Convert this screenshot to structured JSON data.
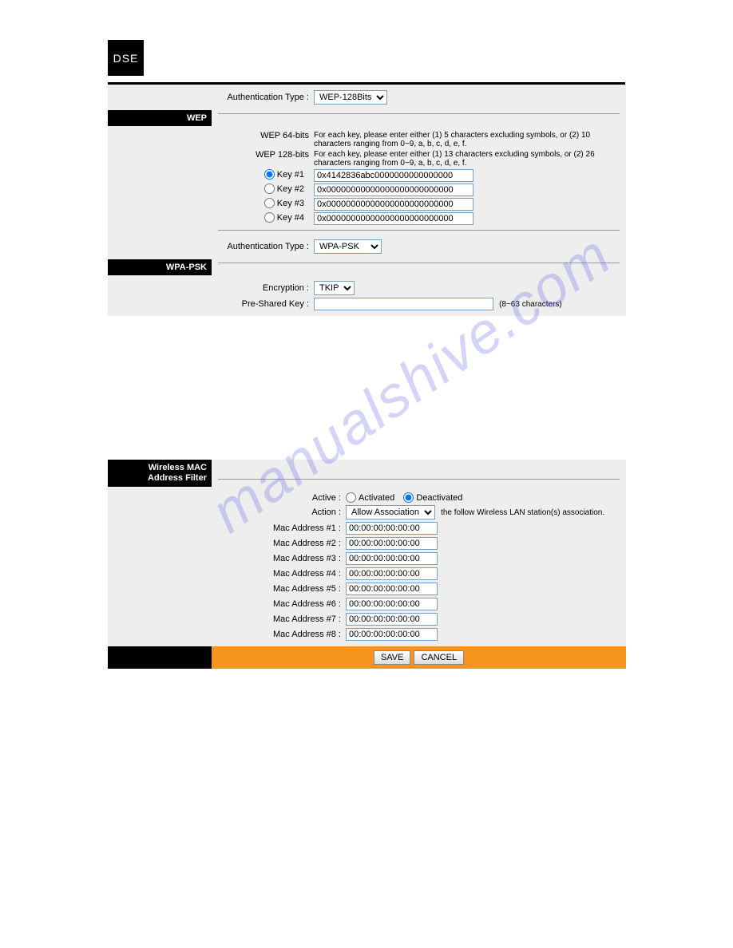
{
  "logo_text": "DSE",
  "watermark_text": "manualshive.com",
  "wep": {
    "auth_label": "Authentication Type :",
    "auth_value": "WEP-128Bits",
    "section_title": "WEP",
    "info64_label": "WEP 64-bits",
    "info64_text": "For each key, please enter either (1) 5 characters excluding symbols, or (2) 10 characters ranging from 0~9, a, b, c, d, e, f.",
    "info128_label": "WEP 128-bits",
    "info128_text": "For each key, please enter either (1) 13 characters excluding symbols, or (2) 26 characters ranging from 0~9, a, b, c, d, e, f.",
    "keys": [
      {
        "label": "Key #1",
        "value": "0x4142836abc0000000000000000",
        "selected": true
      },
      {
        "label": "Key #2",
        "value": "0x00000000000000000000000000",
        "selected": false
      },
      {
        "label": "Key #3",
        "value": "0x00000000000000000000000000",
        "selected": false
      },
      {
        "label": "Key #4",
        "value": "0x00000000000000000000000000",
        "selected": false
      }
    ]
  },
  "wpa": {
    "auth_label": "Authentication Type :",
    "auth_value": "WPA-PSK",
    "section_title": "WPA-PSK",
    "enc_label": "Encryption :",
    "enc_value": "TKIP",
    "psk_label": "Pre-Shared Key :",
    "psk_value": "",
    "psk_note": "(8~63 characters)"
  },
  "macfilter": {
    "section_title": "Wireless MAC Address Filter",
    "active_label": "Active :",
    "activated_label": "Activated",
    "deactivated_label": "Deactivated",
    "active_selected": "Deactivated",
    "action_label": "Action :",
    "action_value": "Allow Association",
    "action_suffix": "the follow Wireless LAN station(s) association.",
    "addresses": [
      {
        "label": "Mac Address #1 :",
        "value": "00:00:00:00:00:00"
      },
      {
        "label": "Mac Address #2 :",
        "value": "00:00:00:00:00:00"
      },
      {
        "label": "Mac Address #3 :",
        "value": "00:00:00:00:00:00"
      },
      {
        "label": "Mac Address #4 :",
        "value": "00:00:00:00:00:00"
      },
      {
        "label": "Mac Address #5 :",
        "value": "00:00:00:00:00:00"
      },
      {
        "label": "Mac Address #6 :",
        "value": "00:00:00:00:00:00"
      },
      {
        "label": "Mac Address #7 :",
        "value": "00:00:00:00:00:00"
      },
      {
        "label": "Mac Address #8 :",
        "value": "00:00:00:00:00:00"
      }
    ]
  },
  "buttons": {
    "save": "SAVE",
    "cancel": "CANCEL"
  }
}
